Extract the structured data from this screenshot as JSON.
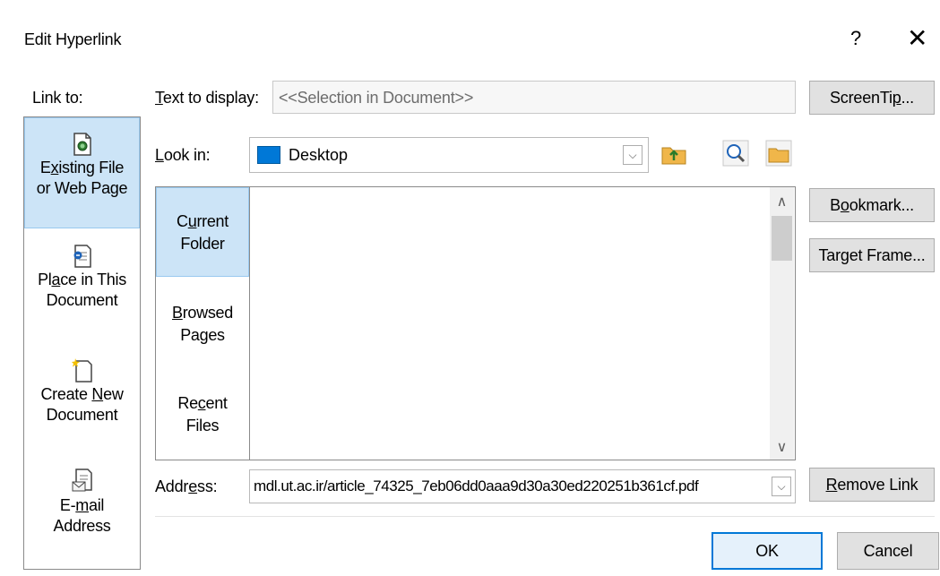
{
  "window": {
    "title": "Edit Hyperlink",
    "help": "?",
    "close": "✕"
  },
  "link_to": {
    "label": "Link to:",
    "items": [
      {
        "pre": "E",
        "u": "x",
        "post": "isting File",
        "line2": "or Web Page",
        "icon": "document-globe-icon",
        "selected": true
      },
      {
        "pre": "Pl",
        "u": "a",
        "post": "ce in This",
        "line2": "Document",
        "icon": "place-in-document-icon",
        "selected": false
      },
      {
        "pre": "Create ",
        "u": "N",
        "post": "ew",
        "line2": "Document",
        "icon": "new-document-icon",
        "selected": false
      },
      {
        "pre": "E-",
        "u": "m",
        "post": "ail",
        "line2": "Address",
        "icon": "email-document-icon",
        "selected": false
      }
    ]
  },
  "text_to_display": {
    "pre": "",
    "u": "T",
    "post": "ext to display:",
    "value": "<<Selection in Document>>"
  },
  "look_in": {
    "pre": "",
    "u": "L",
    "post": "ook in:",
    "value": "Desktop",
    "icon": "desktop-icon"
  },
  "tabs": [
    {
      "line1_pre": "C",
      "line1_u": "u",
      "line1_post": "rrent",
      "line2": "Folder",
      "selected": true
    },
    {
      "line1_pre": "",
      "line1_u": "B",
      "line1_post": "rowsed",
      "line2": "Pages",
      "selected": false
    },
    {
      "line1_pre": "Re",
      "line1_u": "c",
      "line1_post": "ent",
      "line2": "Files",
      "selected": false
    }
  ],
  "address": {
    "pre": "Addr",
    "u": "e",
    "post": "ss:",
    "value": "mdl.ut.ac.ir/article_74325_7eb06dd0aaa9d30a30ed220251b361cf.pdf"
  },
  "buttons": {
    "screentip": {
      "pre": "ScreenTi",
      "u": "p",
      "post": "..."
    },
    "bookmark": {
      "pre": "B",
      "u": "o",
      "post": "okmark..."
    },
    "target_frame": {
      "pre": "Tar",
      "u": "g",
      "post": "et Frame..."
    },
    "remove_link": {
      "pre": "",
      "u": "R",
      "post": "emove Link"
    },
    "ok": "OK",
    "cancel": "Cancel"
  },
  "colors": {
    "selection": "#cce4f7",
    "selection_border": "#99c9ef",
    "button_face": "#e1e1e1",
    "folder": "#f0b64a",
    "desktop": "#0078d7"
  }
}
